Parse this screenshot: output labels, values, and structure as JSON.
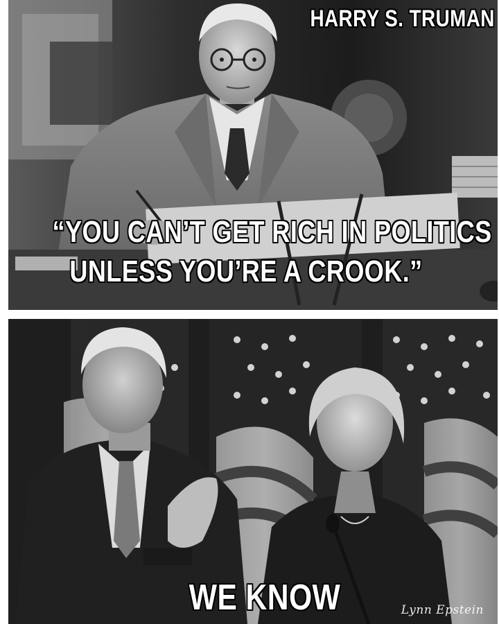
{
  "top_panel": {
    "name_caption": "HARRY S. TRUMAN",
    "quote_line_1": "“YOU CAN’T GET RICH IN POLITICS",
    "quote_line_2": "UNLESS YOU’RE A CROOK.”"
  },
  "bottom_panel": {
    "caption": "WE KNOW",
    "signature": "Lynn Epstein"
  }
}
